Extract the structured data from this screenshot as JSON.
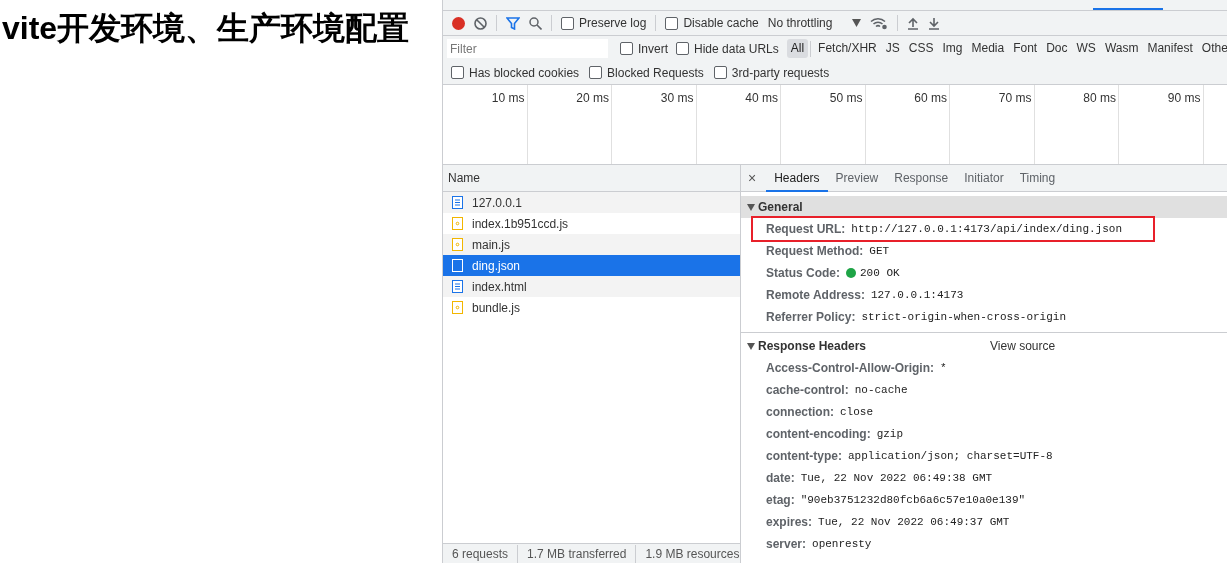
{
  "heading": "vite开发环境、生产环境配置",
  "toolbar": {
    "recording": true,
    "preserve_log": {
      "label": "Preserve log",
      "checked": false
    },
    "disable_cache": {
      "label": "Disable cache",
      "checked": false
    },
    "throttling": "No throttling"
  },
  "filter": {
    "placeholder": "Filter",
    "invert": {
      "label": "Invert",
      "checked": false
    },
    "hide_data_urls": {
      "label": "Hide data URLs",
      "checked": false
    },
    "types": [
      {
        "label": "All",
        "selected": true
      },
      {
        "label": "Fetch/XHR",
        "selected": false
      },
      {
        "label": "JS",
        "selected": false
      },
      {
        "label": "CSS",
        "selected": false
      },
      {
        "label": "Img",
        "selected": false
      },
      {
        "label": "Media",
        "selected": false
      },
      {
        "label": "Font",
        "selected": false
      },
      {
        "label": "Doc",
        "selected": false
      },
      {
        "label": "WS",
        "selected": false
      },
      {
        "label": "Wasm",
        "selected": false
      },
      {
        "label": "Manifest",
        "selected": false
      },
      {
        "label": "Othe",
        "selected": false
      }
    ]
  },
  "more_filters": [
    {
      "label": "Has blocked cookies",
      "checked": false
    },
    {
      "label": "Blocked Requests",
      "checked": false
    },
    {
      "label": "3rd-party requests",
      "checked": false
    }
  ],
  "timeline_ticks": [
    "10 ms",
    "20 ms",
    "30 ms",
    "40 ms",
    "50 ms",
    "60 ms",
    "70 ms",
    "80 ms",
    "90 ms"
  ],
  "requests": {
    "column": "Name",
    "rows": [
      {
        "name": "127.0.0.1",
        "kind": "document",
        "selected": false
      },
      {
        "name": "index.1b951ccd.js",
        "kind": "script",
        "selected": false
      },
      {
        "name": "main.js",
        "kind": "script",
        "selected": false
      },
      {
        "name": "ding.json",
        "kind": "fetch",
        "selected": true
      },
      {
        "name": "index.html",
        "kind": "document",
        "selected": false
      },
      {
        "name": "bundle.js",
        "kind": "script",
        "selected": false
      }
    ]
  },
  "status_bar": [
    "6 requests",
    "1.7 MB transferred",
    "1.9 MB resources"
  ],
  "details": {
    "close": "×",
    "tabs": [
      {
        "label": "Headers",
        "selected": true
      },
      {
        "label": "Preview",
        "selected": false
      },
      {
        "label": "Response",
        "selected": false
      },
      {
        "label": "Initiator",
        "selected": false
      },
      {
        "label": "Timing",
        "selected": false
      }
    ],
    "general": {
      "title": "General",
      "expanded": true,
      "rows": [
        {
          "name": "Request URL:",
          "value": "http://127.0.0.1:4173/api/index/ding.json",
          "highlighted": true
        },
        {
          "name": "Request Method:",
          "value": "GET",
          "highlighted": false
        },
        {
          "name": "Status Code:",
          "value": "200 OK",
          "kind": "status",
          "highlighted": false
        },
        {
          "name": "Remote Address:",
          "value": "127.0.0.1:4173",
          "highlighted": false
        },
        {
          "name": "Referrer Policy:",
          "value": "strict-origin-when-cross-origin",
          "highlighted": false
        }
      ]
    },
    "response": {
      "title": "Response Headers",
      "expanded": true,
      "view_source": "View source",
      "rows": [
        {
          "name": "Access-Control-Allow-Origin:",
          "value": "*"
        },
        {
          "name": "cache-control:",
          "value": "no-cache"
        },
        {
          "name": "connection:",
          "value": "close"
        },
        {
          "name": "content-encoding:",
          "value": "gzip"
        },
        {
          "name": "content-type:",
          "value": "application/json; charset=UTF-8"
        },
        {
          "name": "date:",
          "value": "Tue, 22 Nov 2022 06:49:38 GMT"
        },
        {
          "name": "etag:",
          "value": "\"90eb3751232d80fcb6a6c57e10a0e139\""
        },
        {
          "name": "expires:",
          "value": "Tue, 22 Nov 2022 06:49:37 GMT"
        },
        {
          "name": "server:",
          "value": "openresty"
        }
      ]
    }
  }
}
